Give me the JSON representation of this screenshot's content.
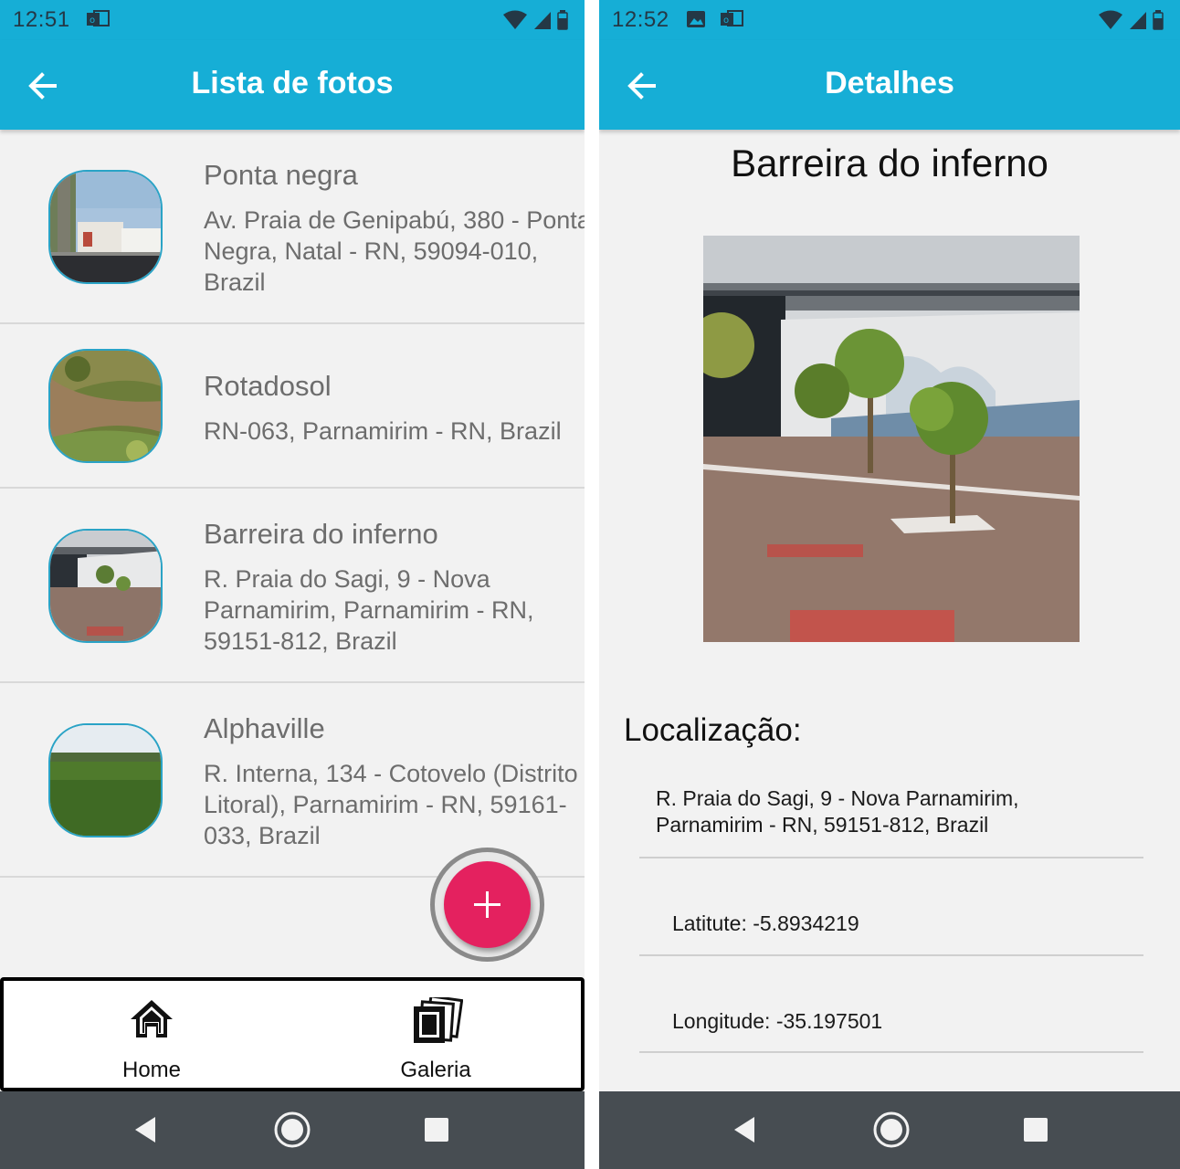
{
  "left": {
    "status_time": "12:51",
    "title": "Lista de fotos",
    "places": [
      {
        "name": "Ponta negra",
        "address": "Av. Praia de Genipabú, 380 - Ponta Negra, Natal - RN, 59094-010, Brazil"
      },
      {
        "name": "Rotadosol",
        "address": "RN-063, Parnamirim - RN, Brazil"
      },
      {
        "name": "Barreira do inferno",
        "address": "R. Praia do Sagi, 9 - Nova Parnamirim, Parnamirim - RN, 59151-812, Brazil"
      },
      {
        "name": "Alphaville",
        "address": "R. Interna, 134 - Cotovelo (Distrito Litoral), Parnamirim - RN, 59161-033, Brazil"
      }
    ],
    "fab_icon": "plus-icon",
    "nav": {
      "home": "Home",
      "gallery": "Galeria"
    }
  },
  "right": {
    "status_time": "12:52",
    "title": "Detalhes",
    "place_name": "Barreira do inferno",
    "location_heading": "Localização:",
    "address": "R. Praia do Sagi, 9 - Nova Parnamirim, Parnamirim - RN, 59151-812, Brazil",
    "latitude": "Latitute: -5.8934219",
    "longitude": "Longitude: -35.197501"
  },
  "colors": {
    "app_bar": "#16aed6",
    "fab": "#e4215f",
    "system_nav": "#474d52"
  }
}
